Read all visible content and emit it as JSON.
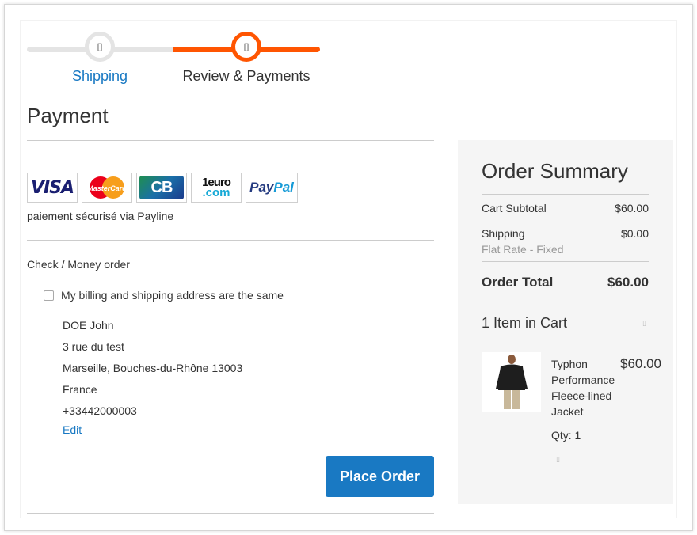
{
  "progress": {
    "steps": [
      {
        "label": "Shipping",
        "icon": "step-marker-icon",
        "state": "complete"
      },
      {
        "label": "Review & Payments",
        "icon": "step-marker-icon",
        "state": "active"
      }
    ],
    "dot_glyph": "▯"
  },
  "payment": {
    "title": "Payment",
    "logos": {
      "visa": "VISA",
      "mastercard": "MasterCard",
      "cb": "CB",
      "euro_big": "1euro",
      "euro_small": ".com",
      "paypal_a": "Pay",
      "paypal_b": "Pal"
    },
    "secure_text": "paiement sécurisé via Payline",
    "method_title": "Check / Money order",
    "same_address_label": "My billing and shipping address are the same",
    "same_address_checked": false,
    "address": {
      "name": "DOE John",
      "street": "3 rue du test",
      "city_line": "Marseille, Bouches-du-Rhône 13003",
      "country": "France",
      "phone": "+33442000003"
    },
    "edit_label": "Edit",
    "place_order_label": "Place Order"
  },
  "summary": {
    "title": "Order Summary",
    "subtotal_label": "Cart Subtotal",
    "subtotal_value": "$60.00",
    "shipping_label": "Shipping",
    "shipping_value": "$0.00",
    "shipping_method": "Flat Rate - Fixed",
    "total_label": "Order Total",
    "total_value": "$60.00",
    "items_title": "1 Item in Cart",
    "chevron_glyph": "▯",
    "item": {
      "name": "Typhon Performance Fleece-lined Jacket",
      "price": "$60.00",
      "qty": "Qty: 1",
      "options_glyph": "▯"
    }
  },
  "colors": {
    "accent_orange": "#ff5501",
    "link_blue": "#1979c3",
    "track_grey": "#e4e4e4"
  }
}
